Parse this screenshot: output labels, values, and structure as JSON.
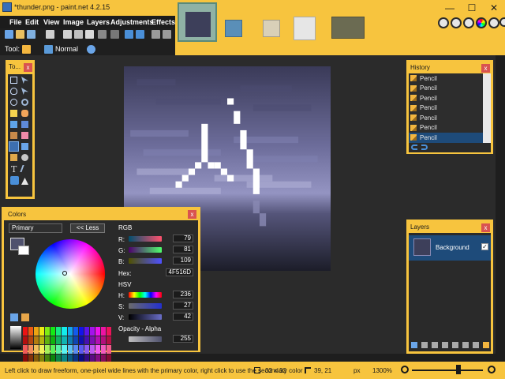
{
  "window": {
    "title": "*thunder.png - paint.net 4.2.15",
    "buttons": {
      "minimize": "—",
      "maximize": "☐",
      "close": "✕"
    }
  },
  "menus": [
    "File",
    "Edit",
    "View",
    "Image",
    "Layers",
    "Adjustments",
    "Effects"
  ],
  "toolbar": {
    "tool_label": "Tool:",
    "blend_mode": "Normal"
  },
  "tools_panel": {
    "title": "To...",
    "close": "x"
  },
  "history_panel": {
    "title": "History",
    "items": [
      "Pencil",
      "Pencil",
      "Pencil",
      "Pencil",
      "Pencil",
      "Pencil",
      "Pencil"
    ]
  },
  "layers_panel": {
    "title": "Layers",
    "layer_name": "Background"
  },
  "colors_panel": {
    "title": "Colors",
    "mode": "Primary",
    "less_button": "<< Less",
    "rgb_label": "RGB",
    "r_label": "R:",
    "r_value": "79",
    "g_label": "G:",
    "g_value": "81",
    "b_label": "B:",
    "b_value": "109",
    "hex_label": "Hex:",
    "hex_value": "4F516D",
    "hsv_label": "HSV",
    "h_label": "H:",
    "h_value": "236",
    "s_label": "S:",
    "s_value": "27",
    "v_label": "V:",
    "v_value": "42",
    "alpha_label": "Opacity - Alpha",
    "alpha_value": "255"
  },
  "statusbar": {
    "hint": "Left click to draw freeform, one-pixel wide lines with the primary color, right click to use the secondary color",
    "image_size": "32 × 32",
    "cursor_pos": "39, 21",
    "units": "px",
    "zoom": "1300%"
  },
  "colors": {
    "chrome": "#f7c43e",
    "primary_color": "#4f516d",
    "accent_blue": "#1e4b7a"
  }
}
